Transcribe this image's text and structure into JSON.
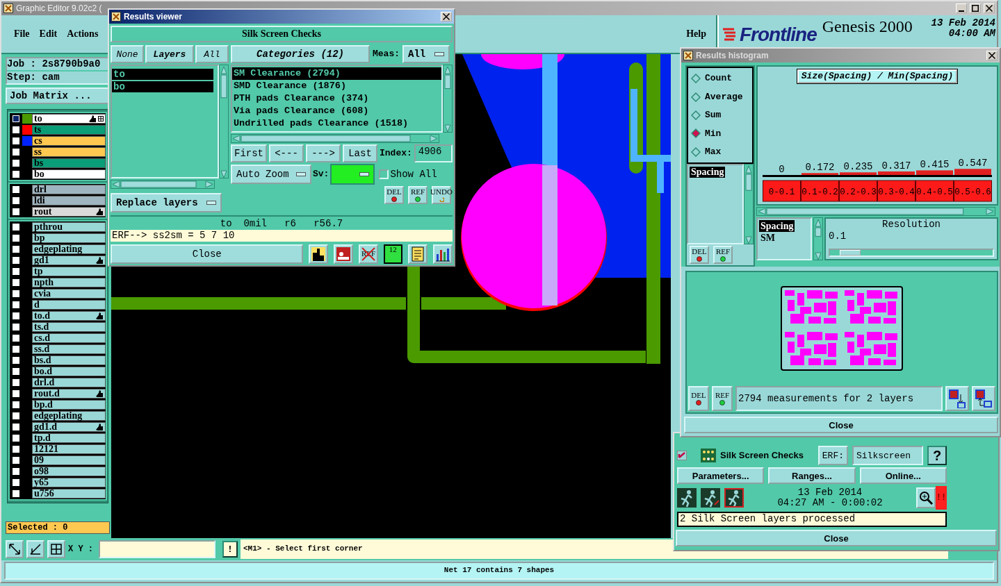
{
  "main_window": {
    "title": "Graphic Editor 9.02c2 (",
    "menu": [
      "File",
      "Edit",
      "Actions",
      "Help"
    ]
  },
  "brand": {
    "logo": "Frontline",
    "product": "Genesis 2000",
    "date": "13 Feb 2014",
    "time": "04:00 AM"
  },
  "job_panel": {
    "job": "Job : 2s8790b9a0",
    "step": "Step: cam",
    "matrix_button": "Job Matrix ...",
    "selected": "Selected : 0"
  },
  "layer_groups": [
    [
      {
        "name": "to",
        "kind": "silk",
        "color": "#4a9a00",
        "work": true,
        "affected": true
      },
      {
        "name": "ts",
        "kind": "mask",
        "color": "#ff0000",
        "work": false,
        "affected": false
      },
      {
        "name": "cs",
        "kind": "signal",
        "color": "#0022ff",
        "work": false,
        "affected": false
      },
      {
        "name": "ss",
        "kind": "signal",
        "work": false,
        "affected": false
      },
      {
        "name": "bs",
        "kind": "mask",
        "work": false,
        "affected": false
      },
      {
        "name": "bo",
        "kind": "silk",
        "work": false,
        "affected": false
      }
    ],
    [
      {
        "name": "drl",
        "kind": "drill",
        "work": false,
        "affected": false
      },
      {
        "name": "ldi",
        "kind": "drill",
        "work": false,
        "affected": false
      },
      {
        "name": "rout",
        "kind": "rout",
        "work": false,
        "affected": true
      }
    ],
    [
      {
        "name": "pthrou",
        "kind": "document",
        "work": false,
        "affected": false
      },
      {
        "name": "bp",
        "kind": "document",
        "work": false,
        "affected": false
      },
      {
        "name": "edgeplating",
        "kind": "document",
        "work": false,
        "affected": false
      },
      {
        "name": "gd1",
        "kind": "document",
        "work": false,
        "affected": true
      },
      {
        "name": "tp",
        "kind": "document",
        "work": false,
        "affected": false
      },
      {
        "name": "npth",
        "kind": "document",
        "work": false,
        "affected": false
      },
      {
        "name": "cvia",
        "kind": "document",
        "work": false,
        "affected": false
      },
      {
        "name": "d",
        "kind": "document",
        "work": false,
        "affected": false
      },
      {
        "name": "to.d",
        "kind": "document",
        "work": false,
        "affected": true
      },
      {
        "name": "ts.d",
        "kind": "document",
        "work": false,
        "affected": false
      },
      {
        "name": "cs.d",
        "kind": "document",
        "work": false,
        "affected": false
      },
      {
        "name": "ss.d",
        "kind": "document",
        "work": false,
        "affected": false
      },
      {
        "name": "bs.d",
        "kind": "document",
        "work": false,
        "affected": false
      },
      {
        "name": "bo.d",
        "kind": "document",
        "work": false,
        "affected": false
      },
      {
        "name": "drl.d",
        "kind": "document",
        "work": false,
        "affected": false
      },
      {
        "name": "rout.d",
        "kind": "document",
        "work": false,
        "affected": true
      },
      {
        "name": "bp.d",
        "kind": "document",
        "work": false,
        "affected": false
      },
      {
        "name": "edgeplating",
        "kind": "document",
        "work": false,
        "affected": false
      },
      {
        "name": "gd1.d",
        "kind": "document",
        "work": false,
        "affected": true
      },
      {
        "name": "tp.d",
        "kind": "document",
        "work": false,
        "affected": false
      },
      {
        "name": "12121",
        "kind": "document",
        "work": false,
        "affected": false
      },
      {
        "name": "09",
        "kind": "document",
        "work": false,
        "affected": false
      },
      {
        "name": "o98",
        "kind": "document",
        "work": false,
        "affected": false
      },
      {
        "name": "y65",
        "kind": "document",
        "work": false,
        "affected": false
      },
      {
        "name": "u756",
        "kind": "document",
        "work": false,
        "affected": false
      }
    ]
  ],
  "bottom_bar": {
    "xy_label": "X Y :",
    "info_button": "!",
    "prompt": "<M1> - Select first corner"
  },
  "status_bar": "Net 17 contains 7 shapes",
  "results_viewer": {
    "title": "Results viewer",
    "check_name": "Silk Screen Checks",
    "layer_buttons": [
      "None",
      "Layers",
      "All"
    ],
    "layers": [
      {
        "name": "to",
        "selected": true
      },
      {
        "name": "bo",
        "selected": true
      }
    ],
    "replace_menu": "Replace layers",
    "categories_button": "Categories (12)",
    "meas_label": "Meas:",
    "meas_value": "All",
    "categories": [
      {
        "label": "SM Clearance (2794)",
        "selected": true
      },
      {
        "label": "SMD Clearance (1876)",
        "selected": false
      },
      {
        "label": "PTH pads Clearance (374)",
        "selected": false
      },
      {
        "label": "Via pads Clearance (608)",
        "selected": false
      },
      {
        "label": "Undrilled pads Clearance (1518)",
        "selected": false
      }
    ],
    "nav_buttons": [
      "First",
      "<---",
      "--->",
      "Last"
    ],
    "index_label": "Index:",
    "index": "4906",
    "zoom_menu": "Auto Zoom",
    "sv_label": "Sv:",
    "sv": {
      "color": "#22ee22"
    },
    "show_all": {
      "label": "Show All",
      "checked": false
    },
    "edit_buttons": [
      "DEL",
      "REF",
      "UNDO"
    ],
    "info": "to  0mil   r6   r56.7",
    "erf_line": "ERF--> ss2sm = 5 7 10",
    "close": "Close",
    "tools": [
      {
        "kind": "figure"
      },
      {
        "kind": "marker"
      },
      {
        "kind": "ref_off",
        "label": "REF"
      },
      {
        "kind": "count",
        "label": "12"
      },
      {
        "kind": "report"
      },
      {
        "kind": "histogram"
      }
    ]
  },
  "histogram": {
    "title": "Results histogram",
    "modes": [
      {
        "label": "Count",
        "selected": false
      },
      {
        "label": "Average",
        "selected": false
      },
      {
        "label": "Sum",
        "selected": false
      },
      {
        "label": "Min",
        "selected": true
      },
      {
        "label": "Max",
        "selected": false
      }
    ],
    "attributes": [
      {
        "label": "Spacing",
        "selected": true
      }
    ],
    "edit_buttons": [
      "DEL",
      "REF"
    ],
    "chart_data": {
      "type": "bar",
      "title": "Size(Spacing) / Min(Spacing)",
      "categories": [
        "0-0.1",
        "0.1-0.2",
        "0.2-0.3",
        "0.3-0.4",
        "0.4-0.5",
        "0.5-0.6"
      ],
      "values": [
        0,
        0.172,
        0.235,
        0.317,
        0.415,
        0.547
      ],
      "data_labels": true
    },
    "sources": [
      {
        "label": "Spacing",
        "selected": true
      },
      {
        "label": "SM",
        "selected": false
      }
    ],
    "resolution_label": "Resolution",
    "resolution": "0.1",
    "resolution_slider": {
      "level": 0.06
    },
    "preview_buttons": [
      "DEL",
      "REF"
    ],
    "summary": "2794 measurements for 2 layers",
    "close": "Close"
  },
  "checks": {
    "enabled": true,
    "name": "Silk Screen Checks",
    "erf_label": "ERF:",
    "erf_value": "Silkscreen",
    "help": "?",
    "buttons": [
      "Parameters...",
      "Ranges...",
      "Online..."
    ],
    "date": "13 Feb 2014",
    "time": "04:27 AM - 0:00:02",
    "alert": "!!",
    "message": "2 Silk Screen layers processed",
    "close": "Close"
  }
}
